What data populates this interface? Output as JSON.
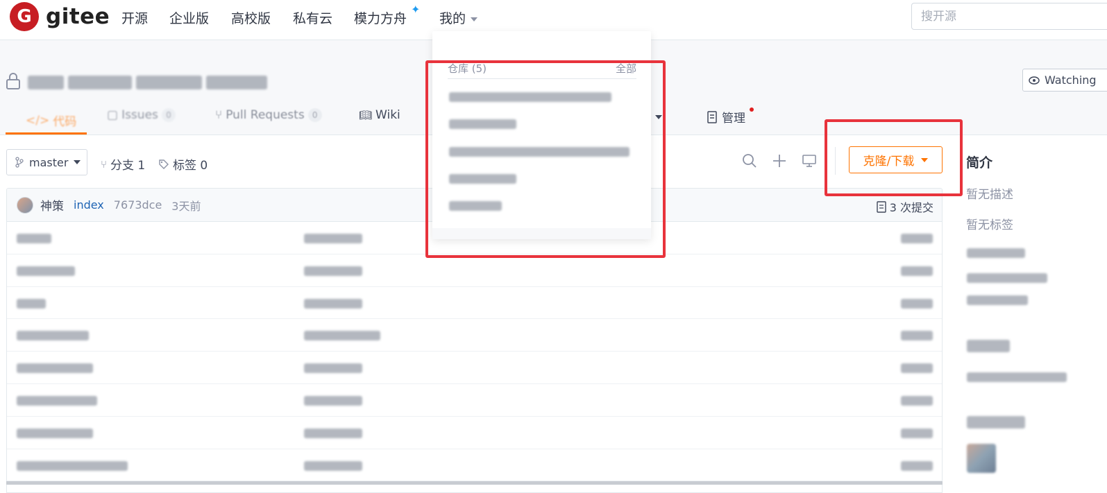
{
  "navbar": {
    "logo_text": "gitee",
    "logo_letter": "G",
    "items": [
      "开源",
      "企业版",
      "高校版",
      "私有云",
      "模力方舟",
      "我的"
    ],
    "star": "✦",
    "search_placeholder": "搜开源"
  },
  "repo": {
    "watch_label": "Watching"
  },
  "tabs": {
    "code": "代码",
    "issues": "Issues",
    "issues_count": "0",
    "pull_requests": "Pull Requests",
    "pr_count": "0",
    "wiki": "Wiki",
    "manage": "管理"
  },
  "toolbar": {
    "branch": "master",
    "branches_label": "分支 1",
    "tags_label": "标签 0",
    "clone_label": "克隆/下载"
  },
  "commit": {
    "author": "神策",
    "message": "index",
    "hash": "7673dce",
    "time": "3天前",
    "count_label": "3 次提交"
  },
  "sidebar": {
    "title": "简介",
    "no_description": "暂无描述",
    "no_tags": "暂无标签"
  },
  "dropdown": {
    "header": "仓库 (5)",
    "all_link": "全部"
  },
  "colors": {
    "brand": "#c71d23",
    "accent": "#fe7300",
    "link": "#1e64b4",
    "annotation": "#e8333c"
  }
}
